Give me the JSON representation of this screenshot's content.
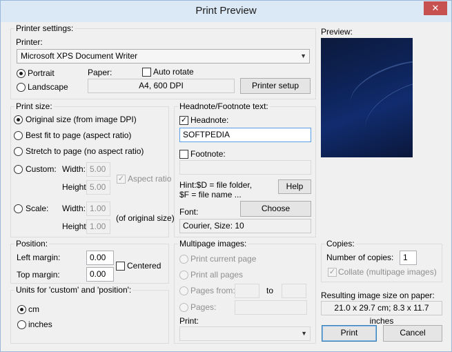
{
  "window": {
    "title": "Print Preview",
    "close_glyph": "✕"
  },
  "printer_settings": {
    "group_label": "Printer settings:",
    "printer_label": "Printer:",
    "printer_value": "Microsoft XPS Document Writer",
    "portrait": "Portrait",
    "landscape": "Landscape",
    "paper_label": "Paper:",
    "auto_rotate": "Auto rotate",
    "paper_value": "A4,         600 DPI",
    "printer_setup": "Printer setup"
  },
  "preview": {
    "label": "Preview:"
  },
  "print_size": {
    "group_label": "Print size:",
    "original": "Original size (from image DPI)",
    "best_fit": "Best fit to page (aspect ratio)",
    "stretch": "Stretch to page (no aspect ratio)",
    "custom": "Custom:",
    "width_label": "Width:",
    "width_value": "5.00",
    "height_label": "Height:",
    "height_value": "5.00",
    "aspect_ratio": "Aspect ratio",
    "scale": "Scale:",
    "scale_width_label": "Width:",
    "scale_width_value": "1.00",
    "scale_height_label": "Height:",
    "scale_height_value": "1.00",
    "of_original": "(of original size)"
  },
  "headnote": {
    "group_label": "Headnote/Footnote text:",
    "headnote_label": "Headnote:",
    "headnote_value": "SOFTPEDIA",
    "footnote_label": "Footnote:",
    "hint_line1": "Hint:$D = file folder,",
    "hint_line2": "$F = file name ...",
    "help": "Help",
    "font_label": "Font:",
    "choose": "Choose",
    "font_value": "Courier, Size: 10"
  },
  "position": {
    "group_label": "Position:",
    "left_margin_label": "Left margin:",
    "left_margin_value": "0.00",
    "top_margin_label": "Top margin:",
    "top_margin_value": "0.00",
    "centered": "Centered"
  },
  "units": {
    "group_label": "Units for 'custom' and 'position':",
    "cm": "cm",
    "inches": "inches"
  },
  "multipage": {
    "group_label": "Multipage images:",
    "current": "Print current page",
    "all": "Print all pages",
    "pages_from": "Pages from:",
    "to": "to",
    "pages": "Pages:",
    "print_label": "Print:"
  },
  "copies": {
    "group_label": "Copies:",
    "number_label": "Number of copies:",
    "number_value": "1",
    "collate": "Collate (multipage images)"
  },
  "result": {
    "label": "Resulting image size on paper:",
    "value": "21.0 x 29.7 cm; 8.3 x 11.7 inches"
  },
  "actions": {
    "print": "Print",
    "cancel": "Cancel"
  }
}
